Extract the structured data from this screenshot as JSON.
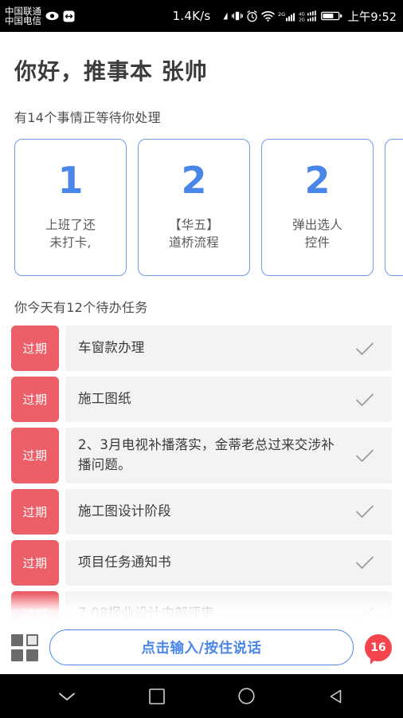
{
  "status_bar": {
    "carrier_line1": "中国联通",
    "carrier_line2": "中国电信",
    "left_icons": [
      "eye-icon",
      "link-icon"
    ],
    "net_speed": "1.4K/s",
    "right_icons": [
      "wifi-signal-icon",
      "vibrate-icon",
      "alarm-clock-icon",
      "wifi-icon",
      "signal-2g-icon",
      "signal-4g-2g-icon",
      "battery-icon"
    ],
    "time": "上午9:52"
  },
  "header": {
    "greeting": "你好，推事本 张帅",
    "subtitle": "有14个事情正等待你处理"
  },
  "cards": [
    {
      "count": "1",
      "label": "上班了还\n未打卡,"
    },
    {
      "count": "2",
      "label": "【华五】\n道桥流程"
    },
    {
      "count": "2",
      "label": "弹出选人\n控件"
    },
    {
      "count": "",
      "label": ""
    }
  ],
  "task_section": {
    "heading": "你今天有12个待办任务",
    "badge_label": "过期",
    "check_icon": "check-icon",
    "rows": [
      {
        "badge": "过期",
        "text": "车窗款办理"
      },
      {
        "badge": "过期",
        "text": "施工图纸"
      },
      {
        "badge": "过期",
        "text": "2、3月电视补播落实，金蒂老总过来交涉补播问题。"
      },
      {
        "badge": "过期",
        "text": "施工图设计阶段"
      },
      {
        "badge": "过期",
        "text": "项目任务通知书"
      },
      {
        "badge": "过期",
        "text": "7.08报业设计内部评审"
      }
    ]
  },
  "bottom_bar": {
    "grid_icon": "grid-apps-icon",
    "speak_button": "点击输入/按住说话",
    "message_count": "16"
  },
  "nav_bar": {
    "items": [
      "chevron-down-icon",
      "recents-square-icon",
      "home-circle-icon",
      "back-triangle-icon"
    ]
  },
  "colors": {
    "accent_blue": "#4a86e8",
    "overdue_red": "#ec5f68",
    "badge_red": "#f4454f",
    "row_bg": "#f2f3f5"
  }
}
